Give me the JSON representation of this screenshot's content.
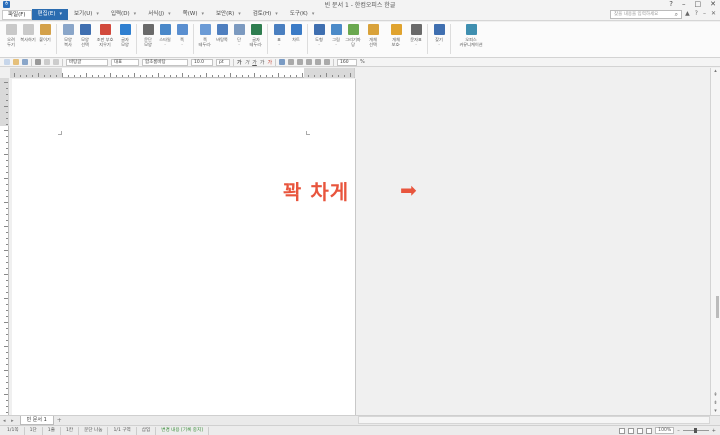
{
  "window": {
    "title": "빈 문서 1 - 한컴오피스 한글",
    "controls": [
      "?",
      "–",
      "□",
      "✕"
    ]
  },
  "menubar": {
    "file": "파일(F)",
    "items": [
      {
        "label": "편집(E)",
        "active": true
      },
      {
        "label": "보기(U)"
      },
      {
        "label": "입력(D)"
      },
      {
        "label": "서식(J)"
      },
      {
        "label": "쪽(W)"
      },
      {
        "label": "보안(R)"
      },
      {
        "label": "검토(H)"
      },
      {
        "label": "도구(K)"
      }
    ],
    "search_placeholder": "찾을 내용을 입력하세요",
    "right_icons": [
      "▲",
      "?",
      "–",
      "✕"
    ]
  },
  "ribbon": {
    "buttons": [
      {
        "label": "오려\n두기",
        "color": "#c9c9c9"
      },
      {
        "label": "복사하기",
        "color": "#c9c9c9"
      },
      {
        "label": "붙이기\n·",
        "color": "#d4a14a"
      },
      {
        "label": "모양\n복사",
        "color": "#8aa6c9"
      },
      {
        "label": "모양\n선택",
        "color": "#3f6fb0"
      },
      {
        "label": "조판 부호\n지우기",
        "color": "#d24a3c"
      },
      {
        "label": "글자\n모양",
        "color": "#2f7fd0"
      },
      {
        "label": "문단\n모양",
        "color": "#6a6a6a"
      },
      {
        "label": "스타일\n·",
        "color": "#4a88c9"
      },
      {
        "label": "쪽\n·",
        "color": "#5a8fd0"
      },
      {
        "label": "쪽\n테두리·",
        "color": "#6b9bd6"
      },
      {
        "label": "바탕쪽",
        "color": "#4f7fbf"
      },
      {
        "label": "단\n·",
        "color": "#7c9ac0"
      },
      {
        "label": "글자\n테두리·",
        "color": "#2e7d4f"
      },
      {
        "label": "표\n·",
        "color": "#4a7fc0"
      },
      {
        "label": "차트",
        "color": "#3b7bc6"
      },
      {
        "label": "도형\n·",
        "color": "#3f6fb0"
      },
      {
        "label": "그림\n·",
        "color": "#4b8ac8"
      },
      {
        "label": "그리기마당",
        "color": "#6aa84f"
      },
      {
        "label": "개체\n선택",
        "color": "#d9a23a"
      },
      {
        "label": "개체\n보호·",
        "color": "#e0a32e"
      },
      {
        "label": "문자표\n·",
        "color": "#6a6a6a"
      },
      {
        "label": "찾기\n·",
        "color": "#3f6fb0"
      },
      {
        "label": "오피스\n커뮤니케이션",
        "color": "#3f8fb0"
      }
    ]
  },
  "toolbar": {
    "style": "바탕글",
    "lang": "대표",
    "font": "함초롬바탕",
    "size": "10.0",
    "unit": "pt",
    "line_spacing": "160",
    "line_unit": "%"
  },
  "document": {
    "annotation": "꽉 차게",
    "arrow": "➡"
  },
  "tabs": {
    "nav": "◂ ▸",
    "doc_tab": "빈 문서 1",
    "add": "+"
  },
  "statusbar": {
    "items": [
      "1/1쪽",
      "1단",
      "1줄",
      "1칸",
      "문단 나눔",
      "1/1 구역",
      "삽입"
    ],
    "green_text": "변경 내용 [기록 중지]",
    "zoom": "100%"
  }
}
